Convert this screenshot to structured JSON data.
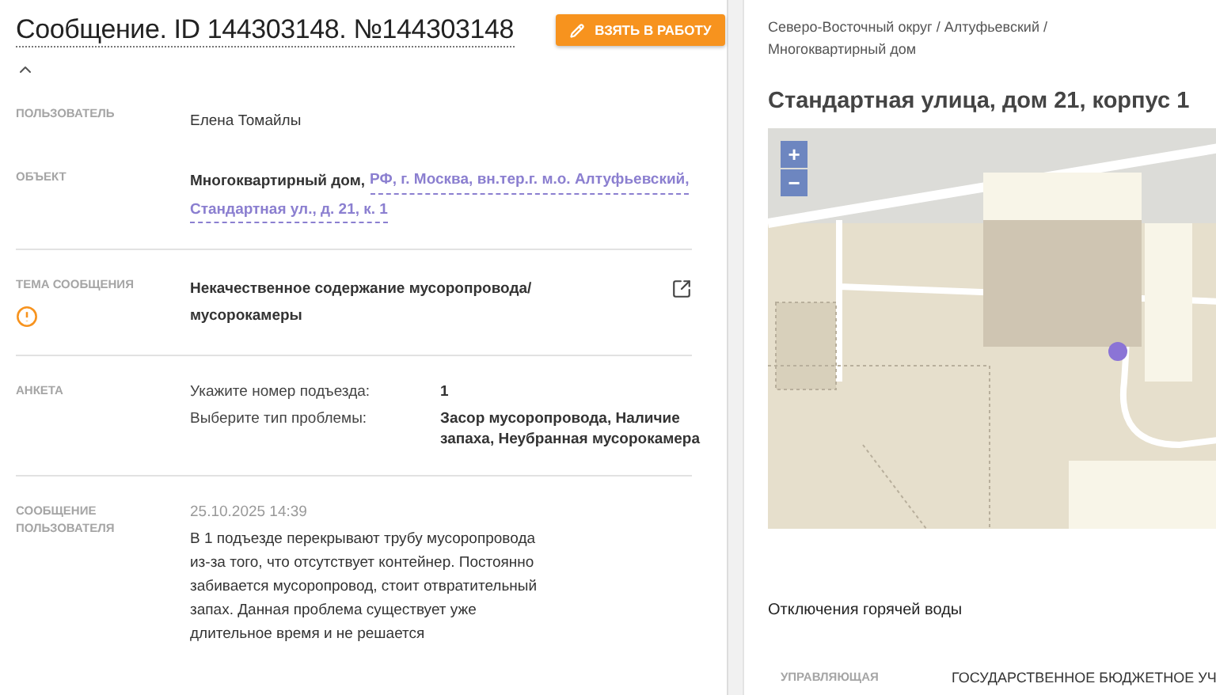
{
  "header": {
    "title": "Сообщение. ID 144303148. №144303148",
    "action_button": "ВЗЯТЬ В РАБОТУ",
    "collapsed": false
  },
  "fields": [
    {
      "kind": "text",
      "label": "ПОЛЬЗОВАТЕЛЬ",
      "value": "Елена Томайлы"
    },
    {
      "kind": "object",
      "label": "ОБЪЕКТ",
      "object_type": "Многоквартирный дом,",
      "address_lines": [
        "РФ, г. Москва, вн.тер.г. м.о. Алтуфьевский,",
        "Стандартная ул., д. 21, к. 1"
      ]
    },
    {
      "kind": "topic",
      "label": "ТЕМА СООБЩЕНИЯ",
      "value": "Некачественное содержание мусоропровода/ мусорокамеры",
      "warning": true
    },
    {
      "kind": "survey",
      "label": "АНКЕТА",
      "answers": [
        {
          "question": "Укажите номер подъезда:",
          "answer": "1"
        },
        {
          "question": "Выберите тип проблемы:",
          "answer": "Засор мусоропровода, Наличие запаха, Неубранная мусорокамера"
        }
      ]
    },
    {
      "kind": "message",
      "label": "СООБЩЕНИЕ ПОЛЬЗОВАТЕЛЯ",
      "date": "25.10.2025 14:39",
      "value": "В 1 подъезде перекрывают трубу мусоропровода из-за того, что отсутствует контейнер. Постоянно забивается мусоропровод, стоит отвратительный запах. Данная проблема существует уже длительное время и не решается"
    }
  ],
  "location": {
    "breadcrumb": "Северо-Восточный округ / Алтуфьевский / Многоквартирный дом",
    "address": "Стандартная улица, дом 21, корпус 1",
    "zoom_in": "+",
    "zoom_out": "−"
  },
  "hot_water": {
    "title": "Отключения горячей воды"
  },
  "info": [
    {
      "label": "УПРАВЛЯЮЩАЯ",
      "value": "ГОСУДАРСТВЕННОЕ БЮДЖЕТНОЕ УЧ"
    }
  ]
}
